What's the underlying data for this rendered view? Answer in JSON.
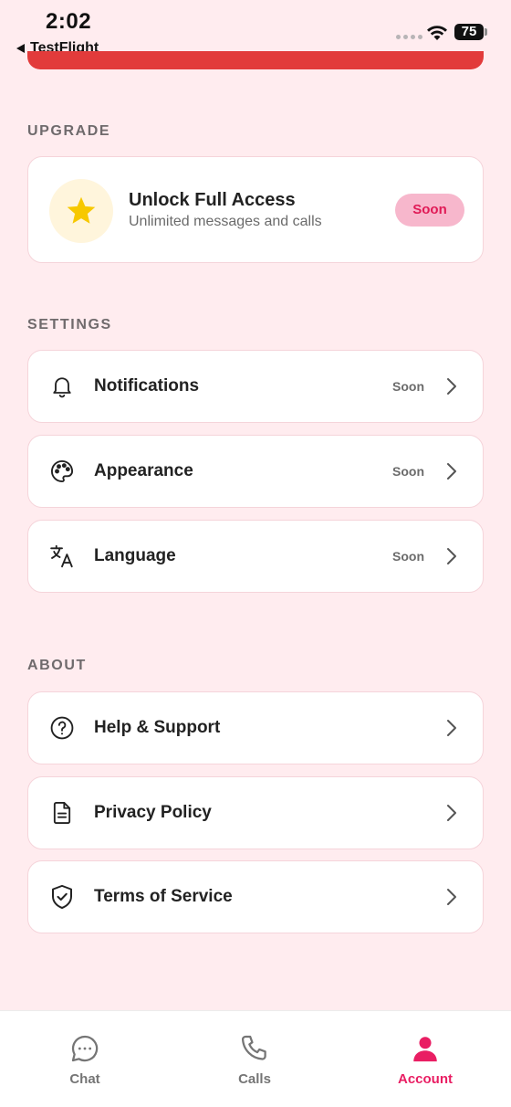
{
  "status_bar": {
    "time": "2:02",
    "back_app": "TestFlight",
    "battery": "75"
  },
  "upgrade": {
    "section_label": "UPGRADE",
    "title": "Unlock Full Access",
    "subtitle": "Unlimited messages and calls",
    "badge": "Soon",
    "icon": "star-icon"
  },
  "settings": {
    "section_label": "SETTINGS",
    "items": [
      {
        "label": "Notifications",
        "status": "Soon",
        "icon": "bell-icon"
      },
      {
        "label": "Appearance",
        "status": "Soon",
        "icon": "palette-icon"
      },
      {
        "label": "Language",
        "status": "Soon",
        "icon": "translate-icon"
      }
    ]
  },
  "about": {
    "section_label": "ABOUT",
    "items": [
      {
        "label": "Help & Support",
        "icon": "help-circle-icon"
      },
      {
        "label": "Privacy Policy",
        "icon": "document-icon"
      },
      {
        "label": "Terms of Service",
        "icon": "shield-check-icon"
      }
    ]
  },
  "tab_bar": {
    "tabs": [
      {
        "label": "Chat",
        "icon": "chat-bubble-icon",
        "active": false
      },
      {
        "label": "Calls",
        "icon": "phone-icon",
        "active": false
      },
      {
        "label": "Account",
        "icon": "person-icon",
        "active": true
      }
    ],
    "active_color": "#e91e63",
    "inactive_color": "#757575"
  },
  "colors": {
    "background": "#ffecef",
    "accent": "#e91e63",
    "progress_strip": "#e23b3b",
    "star": "#f7c800"
  }
}
